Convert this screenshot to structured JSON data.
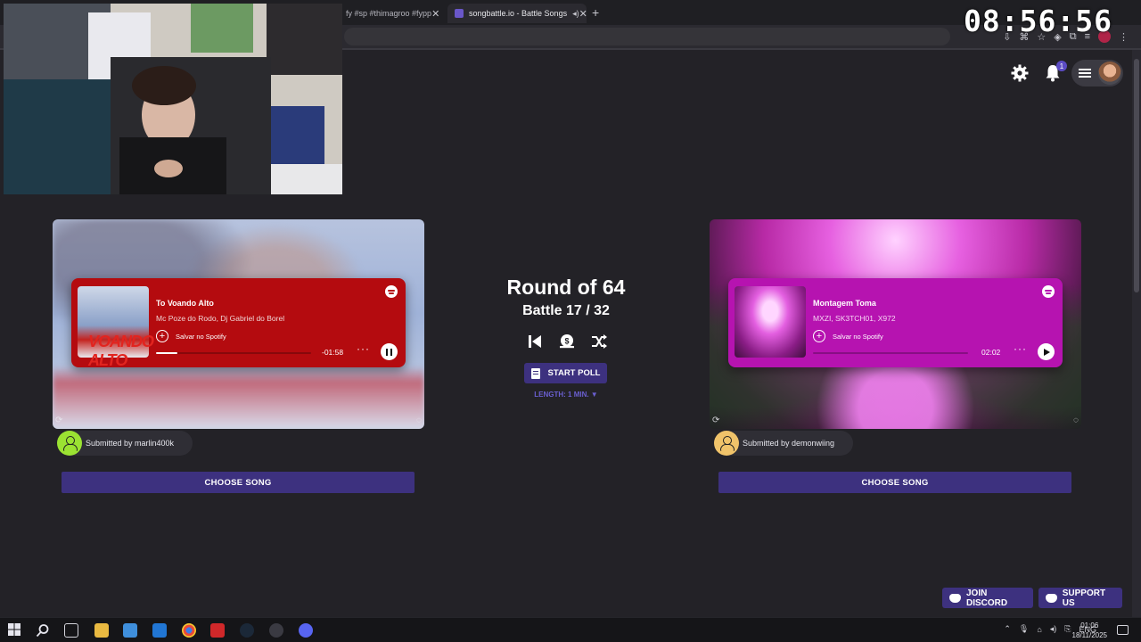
{
  "browser": {
    "tabs": [
      {
        "label": "fy #sp #thimagroo #fypp",
        "active": false
      },
      {
        "label": "songbattle.io - Battle Songs",
        "active": true
      }
    ],
    "close_glyph": "✕",
    "new_tab_glyph": "+"
  },
  "overlay_clock": "08:56:56",
  "battle": {
    "round": "Round of 64",
    "battle": "Battle 17 / 32",
    "start_poll": "START POLL",
    "length": "LENGTH: 1 MIN. ▼"
  },
  "left_song": {
    "title": "To Voando Alto",
    "artist": "Mc Poze do Rodo, Dj Gabriel do Borel",
    "save": "Salvar no Spotify",
    "time": "-01:58",
    "progress": 0.14,
    "state": "playing",
    "cover_text": "VOANDO ALTO",
    "submitted": "Submitted by marlin400k",
    "choose": "CHOOSE SONG",
    "accent": "#b40b0f"
  },
  "right_song": {
    "title": "Montagem Toma",
    "artist": "MXZI, SK3TCH01, X972",
    "save": "Salvar no Spotify",
    "time": "02:02",
    "progress": 0,
    "state": "paused",
    "submitted": "Submitted by demonwiing",
    "choose": "CHOOSE SONG",
    "accent": "#b613b0"
  },
  "header": {
    "notification_count": "1"
  },
  "footer": {
    "discord": "JOIN DISCORD",
    "support": "SUPPORT US"
  },
  "taskbar": {
    "language": "ENG",
    "time": "01:06",
    "date": "18/11/2025"
  },
  "colors": {
    "background": "#232227",
    "button": "#3d317f",
    "link": "#6a5fd0"
  }
}
